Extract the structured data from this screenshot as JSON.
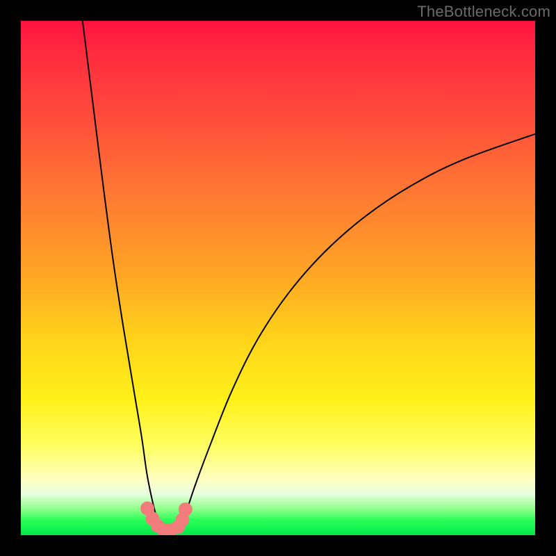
{
  "watermark": "TheBottleneck.com",
  "chart_data": {
    "type": "line",
    "title": "",
    "xlabel": "",
    "ylabel": "",
    "xlim": [
      0,
      100
    ],
    "ylim": [
      0,
      100
    ],
    "grid": false,
    "series": [
      {
        "name": "left-curve",
        "x": [
          12,
          14,
          16,
          18,
          20,
          22,
          23.5,
          24.5,
          25.5,
          26.5,
          27
        ],
        "y": [
          100,
          84,
          68,
          53,
          40,
          28,
          19,
          12,
          7,
          3,
          1
        ]
      },
      {
        "name": "right-curve",
        "x": [
          31,
          32,
          34,
          37,
          41,
          46,
          52,
          59,
          67,
          76,
          86,
          100
        ],
        "y": [
          1,
          4,
          10,
          18,
          28,
          38,
          47,
          55,
          62,
          68,
          73,
          78
        ]
      },
      {
        "name": "bead-cluster",
        "x": [
          24.6,
          25.6,
          26.6,
          27.8,
          29.2,
          30.6,
          31.4,
          32.0
        ],
        "y": [
          5.2,
          3.2,
          1.8,
          1.0,
          1.0,
          1.6,
          3.0,
          5.0
        ]
      }
    ],
    "gradient_bands": [
      {
        "label": "critical",
        "color": "#ff1240",
        "y_from": 92,
        "y_to": 100
      },
      {
        "label": "high",
        "color": "#ff7a32",
        "y_from": 55,
        "y_to": 92
      },
      {
        "label": "medium",
        "color": "#ffd41a",
        "y_from": 25,
        "y_to": 55
      },
      {
        "label": "low",
        "color": "#ffff88",
        "y_from": 8,
        "y_to": 25
      },
      {
        "label": "optimal",
        "color": "#00e84a",
        "y_from": 0,
        "y_to": 8
      }
    ],
    "colors": {
      "curve": "#000000",
      "beads": "#f27c7c",
      "frame": "#000000"
    }
  }
}
